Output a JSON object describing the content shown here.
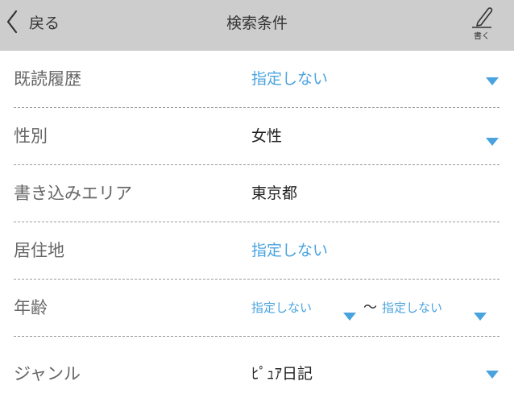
{
  "header": {
    "back_label": "戻る",
    "title": "検索条件",
    "write_label": "書く"
  },
  "colors": {
    "header_bg": "#cdcdcd",
    "accent": "#4aa3df",
    "label": "#666666",
    "divider": "#9a9a9a"
  },
  "rows": {
    "read_history": {
      "label": "既読履歴",
      "value": "指定しない"
    },
    "gender": {
      "label": "性別",
      "value": "女性"
    },
    "post_area": {
      "label": "書き込みエリア",
      "value": "東京都"
    },
    "residence": {
      "label": "居住地",
      "value": "指定しない"
    },
    "age": {
      "label": "年齢",
      "min": "指定しない",
      "separator": "～",
      "max": "指定しない"
    },
    "genre": {
      "label": "ジャンル",
      "value": "ﾋﾟｭｱ日記"
    }
  },
  "icons": {
    "back": "chevron-left-icon",
    "write": "pencil-icon",
    "dropdown": "triangle-down-icon"
  }
}
